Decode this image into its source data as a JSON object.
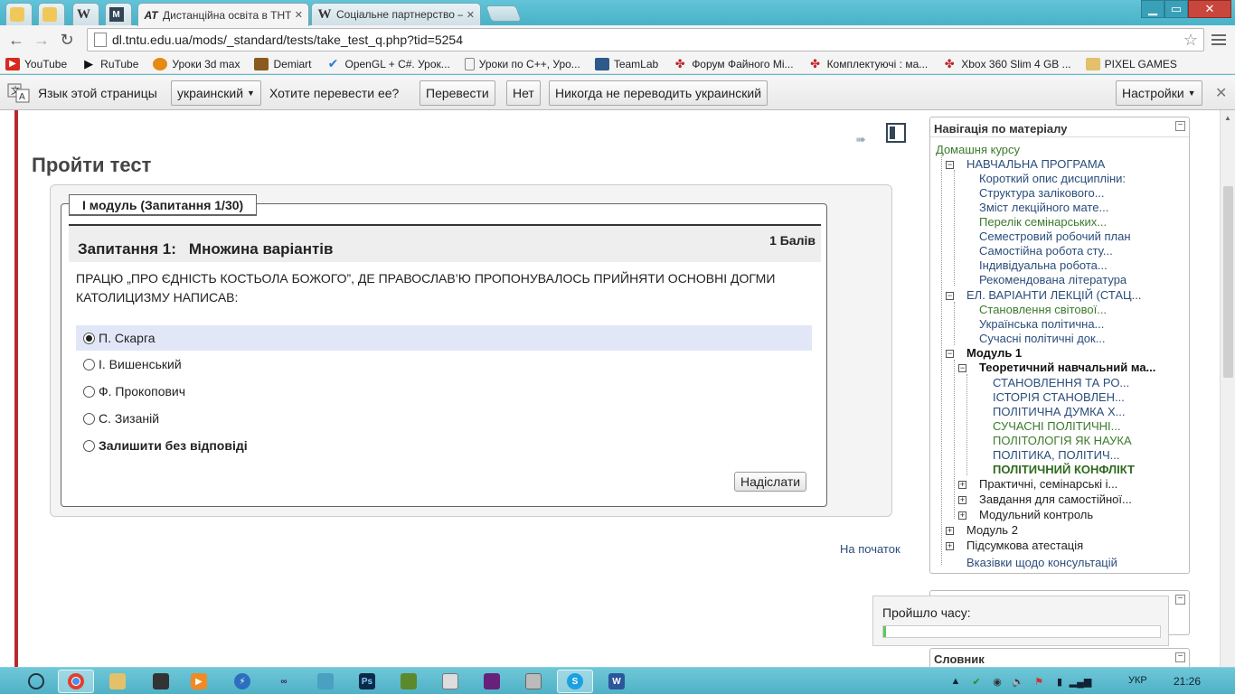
{
  "browser": {
    "tabs": [
      {
        "title": "",
        "icon": "shield-icon"
      },
      {
        "title": "",
        "icon": "shield-icon"
      },
      {
        "title": "",
        "icon": "wikipedia-icon",
        "glyph": "W"
      },
      {
        "title": "",
        "icon": "moodle-icon",
        "glyph": "M"
      },
      {
        "title": "Дистанційна освіта в ТНТ",
        "icon": "at-icon",
        "glyph": "AT",
        "active": true
      },
      {
        "title": "Соціальне партнерство –",
        "icon": "wikipedia-icon",
        "glyph": "W"
      }
    ],
    "window_buttons": {
      "minimize": "▁",
      "maximize": "▭",
      "close": "✕"
    },
    "url": "dl.tntu.edu.ua/mods/_standard/tests/take_test_q.php?tid=5254",
    "bookmarks": [
      {
        "label": "YouTube",
        "icon": "youtube-icon",
        "color": "#d62a1e"
      },
      {
        "label": "RuTube",
        "icon": "play-icon",
        "color": "#111111"
      },
      {
        "label": "Уроки 3d max",
        "icon": "ball-icon",
        "color": "#e58a12"
      },
      {
        "label": "Demiart",
        "icon": "demiart-icon",
        "color": "#8a5a1e"
      },
      {
        "label": "OpenGL + C#. Урок...",
        "icon": "check-icon",
        "color": "#2a7cd1"
      },
      {
        "label": "Уроки по C++, Уро...",
        "icon": "page-icon",
        "color": "#888888"
      },
      {
        "label": "TeamLab",
        "icon": "teamlab-icon",
        "color": "#2d5a8a"
      },
      {
        "label": "Форум Файного Мі...",
        "icon": "forum-icon",
        "color": "#c0262d"
      },
      {
        "label": "Комплектуючі : ма...",
        "icon": "forum-icon",
        "color": "#c0262d"
      },
      {
        "label": "Xbox 360 Slim 4 GB ...",
        "icon": "forum-icon",
        "color": "#c0262d"
      },
      {
        "label": "PIXEL GAMES",
        "icon": "folder-icon",
        "color": "#e3c06a"
      }
    ]
  },
  "translate_bar": {
    "prompt": "Язык этой страницы",
    "language": "украинский",
    "question": "Хотите перевести ее?",
    "translate_button": "Перевести",
    "no_button": "Нет",
    "never_button": "Никогда не переводить украинский",
    "settings_button": "Настройки"
  },
  "page": {
    "title": "Пройти тест",
    "to_top": "На початок"
  },
  "test": {
    "legend": "І модуль (Запитання 1/30)",
    "question_label": "Запитання 1:",
    "question_type": "Множина варіантів",
    "points": "1 Балів",
    "question_text": "ПРАЦЮ „ПРО ЄДНІСТЬ КОСТЬОЛА БОЖОГО”, ДЕ ПРАВОСЛАВ’Ю ПРОПОНУВАЛОСЬ ПРИЙНЯТИ ОСНОВНІ ДОГМИ КАТОЛИЦИЗМУ НАПИСАВ:",
    "options": [
      {
        "label": "П. Скарга",
        "selected": true
      },
      {
        "label": "І. Вишенський",
        "selected": false
      },
      {
        "label": "Ф. Прокопович",
        "selected": false
      },
      {
        "label": "С. Зизаній",
        "selected": false
      },
      {
        "label": "Залишити без відповіді",
        "selected": false,
        "bold": true
      }
    ],
    "submit": "Надіслати"
  },
  "navigation": {
    "title": "Навігація по матеріалу",
    "home": "Домашня курсу",
    "items": {
      "program": "НАВЧАЛЬНА ПРОГРАМА",
      "p1": "Короткий опис дисципліни:",
      "p2": "Структура залікового...",
      "p3": "Зміст лекційного мате...",
      "p4": "Перелік семінарських...",
      "p5": "Семестровий робочий план",
      "p6": "Самостійна робота сту...",
      "p7": "Індивідуальна робота...",
      "p8": "Рекомендована література",
      "el": "ЕЛ. ВАРІАНТИ ЛЕКЦІЙ (СТАЦ...",
      "e1": "Становлення світової...",
      "e2": "Українська політична...",
      "e3": "Сучасні політичні док...",
      "module1": "Модуль 1",
      "theory": "Теоретичний навчальний ма...",
      "t1": "СТАНОВЛЕННЯ ТА РО...",
      "t2": "ІСТОРІЯ СТАНОВЛЕН...",
      "t3": "ПОЛІТИЧНА ДУМКА Х...",
      "t4": "СУЧАСНІ ПОЛІТИЧНІ...",
      "t5": "ПОЛІТОЛОГІЯ ЯК НАУКА",
      "t6": "ПОЛІТИКА, ПОЛІТИЧ...",
      "t7": "ПОЛІТИЧНИЙ КОНФЛІКТ",
      "practical": "Практичні, семінарські і...",
      "tasks": "Завдання для самостійної...",
      "control": "Модульний контроль",
      "module2": "Модуль 2",
      "final": "Підсумкова атестація",
      "consult": "Вказівки щодо консультацій"
    }
  },
  "timer": {
    "label": "Пройшло часу:",
    "progress": 0.01
  },
  "dictionary": {
    "title": "Словник"
  },
  "taskbar": {
    "language": "УКР",
    "clock": "21:26"
  }
}
